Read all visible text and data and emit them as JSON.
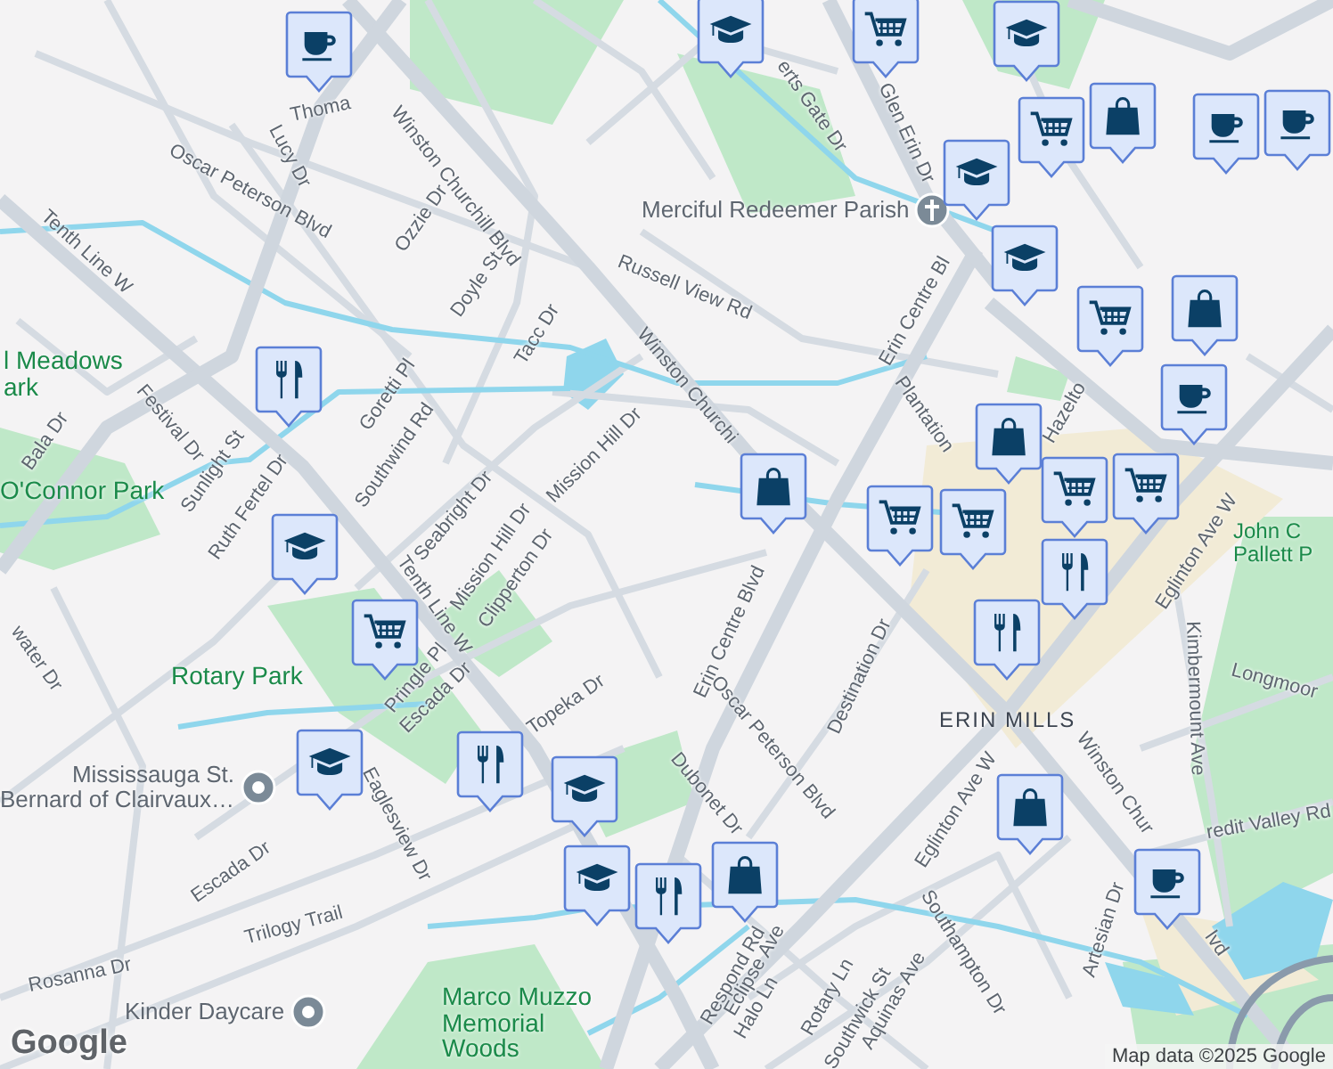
{
  "map": {
    "street_labels": [
      "Thoma",
      "Winston Churchill Blvd",
      "Lucy Dr",
      "Oscar Peterson Blvd",
      "Ozzie Dr",
      "Tenth Line W",
      "Doyle St",
      "Russell View Rd",
      "Tacc Dr",
      "Winston Churchi",
      "Festival Dr",
      "Goretti Pl",
      "Bala Dr",
      "Sunlight St",
      "Southwind Rd",
      "Ruth Fertel Dr",
      "Seabright Dr",
      "Mission Hill Dr",
      "Mission Hill Dr",
      "Clipperton Dr",
      "Tenth Line W",
      "Pringle Pl",
      "Escada Dr",
      "Topeka Dr",
      "Eaglesview Dr",
      "Escada Dr",
      "Trilogy Trail",
      "Rosanna Dr",
      "water Dr",
      "erts Gate Dr",
      "Glen Erin Dr",
      "Erin Centre Bl",
      "Plantation",
      "Hazelto",
      "Erin Centre Blvd",
      "Oscar Peterson Blvd",
      "Destination Dr",
      "Dubonet Dr",
      "Eglinton Ave W",
      "Eglinton Ave W",
      "Kimbermount Ave",
      "Longmoor",
      "Winston Chur",
      "lvd",
      "redit Valley Rd",
      "Southampton Dr",
      "Artesian Dr",
      "Respond Rd",
      "Eclipse Ave",
      "Halo Ln",
      "Rotary Ln",
      "Southwick St",
      "Aquinas Ave"
    ],
    "park_labels": [
      "l Meadows\nark",
      "O'Connor Park",
      "Rotary Park",
      "Marco Muzzo\nMemorial\nWoods",
      "John C\nPallett P"
    ],
    "area_label": "ERIN MILLS",
    "places": [
      {
        "name": "Merciful Redeemer Parish",
        "kind": "church"
      },
      {
        "name": "Mississauga St.\nBernard of Clairvaux…",
        "kind": "place"
      },
      {
        "name": "Kinder Daycare",
        "kind": "place"
      }
    ],
    "markers": [
      {
        "kind": "cafe"
      },
      {
        "kind": "school"
      },
      {
        "kind": "grocery"
      },
      {
        "kind": "school"
      },
      {
        "kind": "grocery"
      },
      {
        "kind": "shop"
      },
      {
        "kind": "school"
      },
      {
        "kind": "cafe"
      },
      {
        "kind": "cafe"
      },
      {
        "kind": "school"
      },
      {
        "kind": "grocery"
      },
      {
        "kind": "shop"
      },
      {
        "kind": "cafe"
      },
      {
        "kind": "shop"
      },
      {
        "kind": "grocery"
      },
      {
        "kind": "grocery"
      },
      {
        "kind": "shop"
      },
      {
        "kind": "grocery"
      },
      {
        "kind": "grocery"
      },
      {
        "kind": "restaurant"
      },
      {
        "kind": "restaurant"
      },
      {
        "kind": "restaurant"
      },
      {
        "kind": "school"
      },
      {
        "kind": "grocery"
      },
      {
        "kind": "school"
      },
      {
        "kind": "restaurant"
      },
      {
        "kind": "school"
      },
      {
        "kind": "school"
      },
      {
        "kind": "restaurant"
      },
      {
        "kind": "shop"
      },
      {
        "kind": "shop"
      },
      {
        "kind": "cafe"
      }
    ]
  },
  "logo": "Google",
  "attribution": "Map data ©2025 Google"
}
